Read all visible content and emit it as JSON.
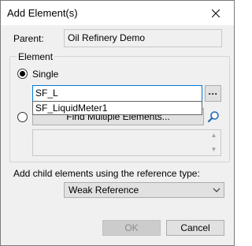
{
  "dialog": {
    "title": "Add Element(s)",
    "close_icon": "close-icon"
  },
  "parent": {
    "label": "Parent:",
    "value": "Oil Refinery Demo"
  },
  "element_group": {
    "label": "Element",
    "single": {
      "label": "Single",
      "selected": true,
      "input_value": "SF_L",
      "browse_label": "···",
      "autocomplete_item": "SF_LiquidMeter1"
    },
    "multiple": {
      "selected": false,
      "find_button_label": "Find Multiple Elements...",
      "search_icon": "search-icon",
      "scroll_up_icon": "scroll-up-icon",
      "scroll_down_icon": "scroll-down-icon"
    }
  },
  "reference": {
    "label": "Add child elements using the reference type:",
    "selected": "Weak Reference",
    "chevron_icon": "chevron-down-icon"
  },
  "buttons": {
    "ok_label": "OK",
    "ok_enabled": false,
    "cancel_label": "Cancel"
  },
  "colors": {
    "focus_border": "#0078d7",
    "dialog_background": "#f0f0f0",
    "button_face": "#e1e1e1",
    "disabled_text": "#8c8c8c"
  }
}
